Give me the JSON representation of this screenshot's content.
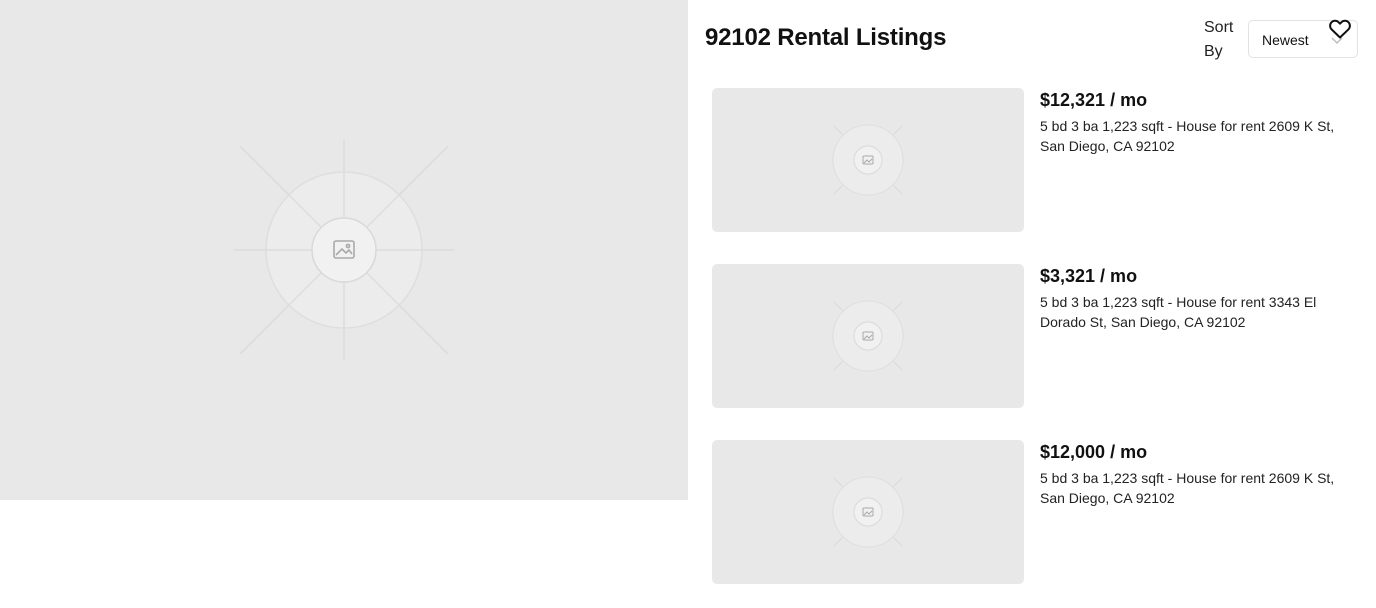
{
  "header": {
    "title": "92102 Rental Listings",
    "sort_label": "Sort By",
    "sort_value": "Newest"
  },
  "icons": {
    "favorite": "heart-icon",
    "sort_chevron": "chevron-down-icon",
    "image_placeholder": "image-icon"
  },
  "listings": [
    {
      "price": "$12,321 / mo",
      "description": "5 bd 3 ba 1,223 sqft - House for rent 2609 K St, San Diego, CA 92102"
    },
    {
      "price": "$3,321 / mo",
      "description": "5 bd 3 ba 1,223 sqft - House for rent 3343 El Dorado St, San Diego, CA 92102"
    },
    {
      "price": "$12,000 / mo",
      "description": "5 bd 3 ba 1,223 sqft - House for rent 2609 K St, San Diego, CA 92102"
    }
  ],
  "colors": {
    "placeholder_bg": "#e8e8e8",
    "text": "#111111"
  }
}
